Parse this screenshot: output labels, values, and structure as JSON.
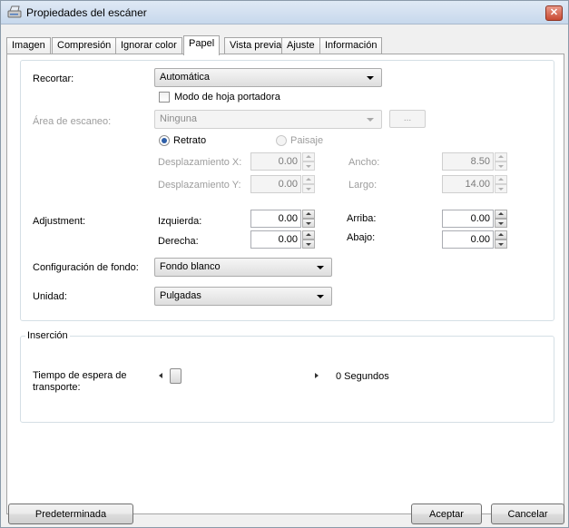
{
  "window": {
    "title": "Propiedades del escáner",
    "close_glyph": "✕"
  },
  "tabs": [
    {
      "label": "Imagen"
    },
    {
      "label": "Compresión"
    },
    {
      "label": "Ignorar color"
    },
    {
      "label": "Papel"
    },
    {
      "label": "Vista previa"
    },
    {
      "label": "Ajuste"
    },
    {
      "label": "Información"
    }
  ],
  "active_tab": "Papel",
  "paper": {
    "recortar_label": "Recortar:",
    "recortar_value": "Automática",
    "carrier_label": "Modo de hoja portadora",
    "carrier_checked": false,
    "scan_area_label": "Área de escaneo:",
    "scan_area_value": "Ninguna",
    "scan_area_button": "...",
    "portrait_label": "Retrato",
    "landscape_label": "Paisaje",
    "orientation": "Retrato",
    "offset_x_label": "Desplazamiento X:",
    "offset_x_value": "0.00",
    "offset_y_label": "Desplazamiento Y:",
    "offset_y_value": "0.00",
    "width_label": "Ancho:",
    "width_value": "8.50",
    "length_label": "Largo:",
    "length_value": "14.00",
    "adjustment_label": "Adjustment:",
    "left_label": "Izquierda:",
    "left_value": "0.00",
    "right_label": "Derecha:",
    "right_value": "0.00",
    "top_label": "Arriba:",
    "top_value": "0.00",
    "bottom_label": "Abajo:",
    "bottom_value": "0.00",
    "background_label": "Configuración de fondo:",
    "background_value": "Fondo blanco",
    "unit_label": "Unidad:",
    "unit_value": "Pulgadas"
  },
  "insertion": {
    "group_label": "Inserción",
    "timeout_label_line1": "Tiempo de espera de",
    "timeout_label_line2": "transporte:",
    "timeout_value_text": "0 Segundos",
    "timeout_fraction": 0
  },
  "buttons": {
    "default": "Predeterminada",
    "ok": "Aceptar",
    "cancel": "Cancelar"
  }
}
